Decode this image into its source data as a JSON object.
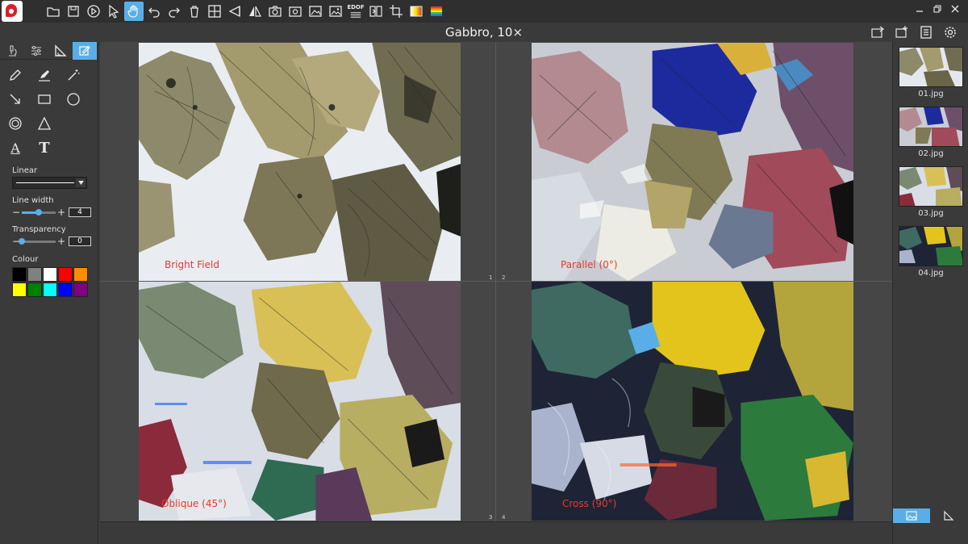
{
  "window": {
    "title": "Gabbro, 10×"
  },
  "toolbar": {
    "tools": [
      {
        "name": "open-folder-icon"
      },
      {
        "name": "save-icon"
      },
      {
        "name": "play-icon"
      },
      {
        "name": "select-arrow-icon"
      },
      {
        "name": "pan-hand-icon",
        "active": true
      },
      {
        "name": "undo-icon"
      },
      {
        "name": "redo-icon"
      },
      {
        "name": "delete-icon"
      },
      {
        "name": "layout-grid-icon"
      },
      {
        "name": "flip-horizontal-icon"
      },
      {
        "name": "mirror-icon"
      },
      {
        "name": "camera-icon"
      },
      {
        "name": "snapshot-icon"
      },
      {
        "name": "image-capture-icon"
      },
      {
        "name": "gallery-icon"
      },
      {
        "name": "edof-icon",
        "label": "EDOF"
      },
      {
        "name": "stitch-icon"
      },
      {
        "name": "crop-icon"
      },
      {
        "name": "white-balance-icon"
      },
      {
        "name": "color-bars-icon"
      }
    ]
  },
  "left_panel": {
    "line_type": {
      "label": "Linear"
    },
    "line_width": {
      "label": "Line width",
      "value": "4",
      "fraction": 0.5
    },
    "transparency": {
      "label": "Transparency",
      "value": "0",
      "fraction": 0.0
    },
    "colour": {
      "label": "Colour",
      "swatches": [
        "#000000",
        "#808080",
        "#ffffff",
        "#ff0000",
        "#ff8c00",
        "#ffff00",
        "#008000",
        "#00ffff",
        "#0000ff",
        "#800080"
      ]
    },
    "text_tool_glyph": "T",
    "underline_text_glyph": "A"
  },
  "viewer": {
    "quadrants": [
      {
        "label": "Bright Field",
        "number": "1"
      },
      {
        "label": "Parallel (0°)",
        "number": "2"
      },
      {
        "label": "Oblique (45°)",
        "number": "3"
      },
      {
        "label": "Cross (90°)",
        "number": "4"
      }
    ]
  },
  "thumbnails": [
    {
      "caption": "01.jpg"
    },
    {
      "caption": "02.jpg"
    },
    {
      "caption": "03.jpg"
    },
    {
      "caption": "04.jpg"
    }
  ]
}
